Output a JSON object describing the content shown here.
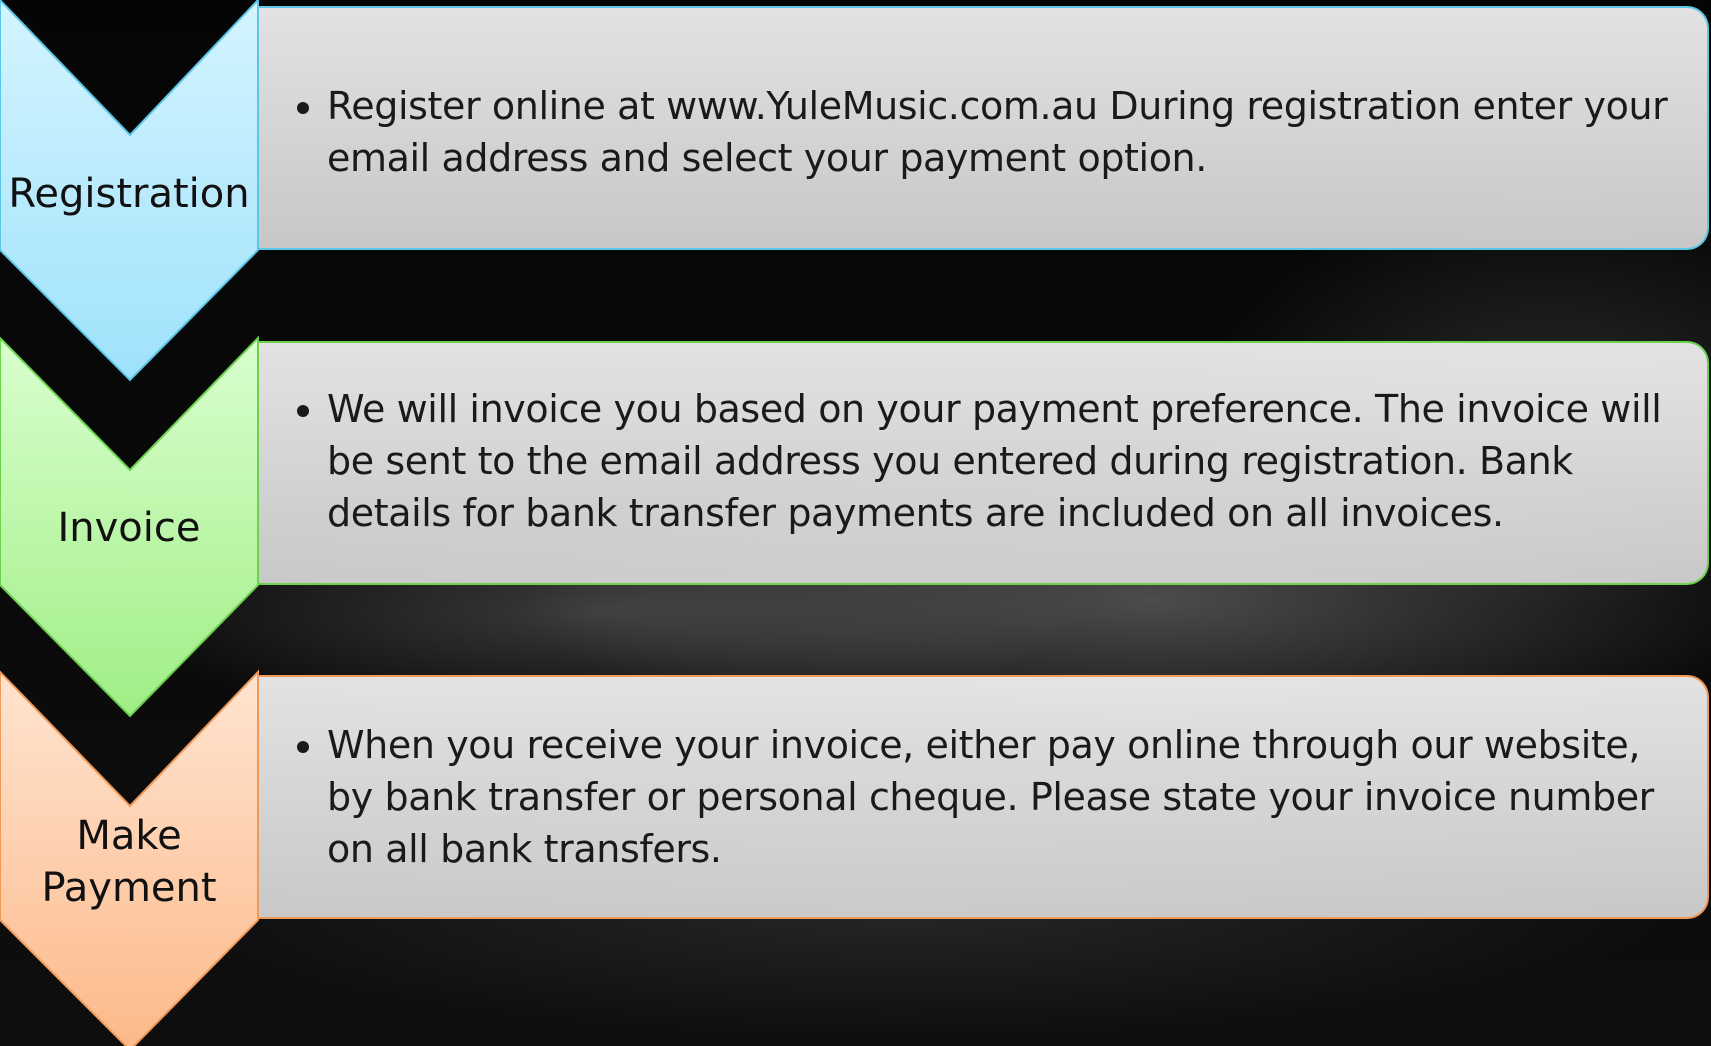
{
  "steps": [
    {
      "label": "Registration",
      "text": "Register online at www.YuleMusic.com.au During registration enter your email address and select your payment option.",
      "color": "#a8e6fb",
      "color_light": "#c9f2ff",
      "border": "#5bc6e8"
    },
    {
      "label": "Invoice",
      "text": "We will invoice you based on your payment preference. The invoice will be sent to the email address you entered during registration. Bank details for bank transfer payments are included on all invoices.",
      "color": "#a3f08a",
      "color_light": "#d6ffc8",
      "border": "#6cd24e"
    },
    {
      "label": "Make\nPayment",
      "text": "When you receive your invoice, either pay online through our website, by bank transfer or personal cheque. Please state your invoice number on all bank transfers.",
      "color": "#fdbf93",
      "color_light": "#ffe0c8",
      "border": "#f09a5a"
    }
  ]
}
